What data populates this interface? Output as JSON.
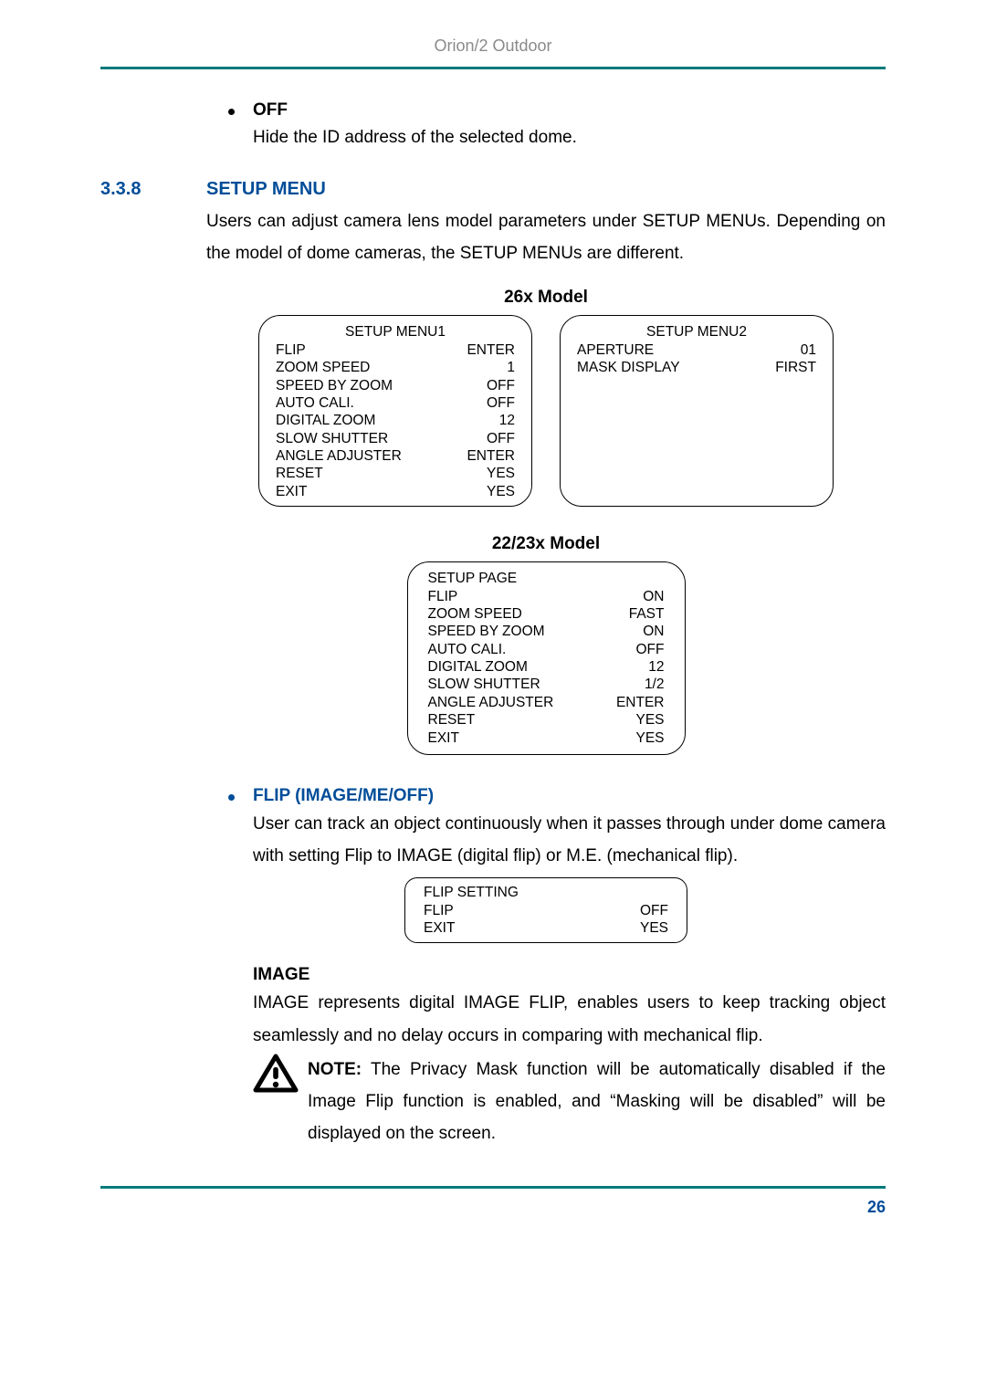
{
  "header": "Orion/2 Outdoor",
  "off_section": {
    "label": "OFF",
    "text": "Hide the ID address of the selected dome."
  },
  "section": {
    "num": "3.3.8",
    "title": "SETUP MENU",
    "body": "Users can adjust camera lens model parameters under SETUP MENUs. Depending on the model of dome cameras, the SETUP MENUs are different."
  },
  "model26": {
    "title": "26x Model",
    "menu1": {
      "title": "SETUP MENU1",
      "rows": [
        {
          "k": "FLIP",
          "v": "ENTER"
        },
        {
          "k": "ZOOM SPEED",
          "v": "1"
        },
        {
          "k": "SPEED BY ZOOM",
          "v": "OFF"
        },
        {
          "k": "AUTO CALI.",
          "v": "OFF"
        },
        {
          "k": "DIGITAL ZOOM",
          "v": "12"
        },
        {
          "k": "SLOW SHUTTER",
          "v": "OFF"
        },
        {
          "k": "ANGLE ADJUSTER",
          "v": "ENTER"
        },
        {
          "k": "RESET",
          "v": "YES"
        },
        {
          "k": "EXIT",
          "v": "YES"
        }
      ]
    },
    "menu2": {
      "title": "SETUP MENU2",
      "rows": [
        {
          "k": "APERTURE",
          "v": "01"
        },
        {
          "k": "MASK DISPLAY",
          "v": "FIRST"
        }
      ]
    }
  },
  "model22": {
    "title": "22/23x Model",
    "menu": {
      "title": "SETUP PAGE",
      "rows": [
        {
          "k": "FLIP",
          "v": "ON"
        },
        {
          "k": "ZOOM SPEED",
          "v": "FAST"
        },
        {
          "k": "SPEED BY ZOOM",
          "v": "ON"
        },
        {
          "k": "AUTO CALI.",
          "v": "OFF"
        },
        {
          "k": "DIGITAL ZOOM",
          "v": "12"
        },
        {
          "k": "SLOW SHUTTER",
          "v": "1/2"
        },
        {
          "k": "ANGLE ADJUSTER",
          "v": "ENTER"
        },
        {
          "k": "RESET",
          "v": "YES"
        },
        {
          "k": "EXIT",
          "v": "YES"
        }
      ]
    }
  },
  "flip_section": {
    "label": "FLIP (IMAGE/ME/OFF)",
    "body": "User can track an object continuously when it passes through under dome camera with setting Flip to IMAGE (digital flip) or M.E. (mechanical flip).",
    "box": {
      "title": "FLIP SETTING",
      "rows": [
        {
          "k": "FLIP",
          "v": "OFF"
        },
        {
          "k": "EXIT",
          "v": "YES"
        }
      ]
    }
  },
  "image_section": {
    "title": "IMAGE",
    "body": "IMAGE represents digital IMAGE FLIP, enables users to keep tracking object seamlessly and no delay occurs in comparing with mechanical flip.",
    "note_bold": "NOTE:",
    "note_text": " The Privacy Mask function will be automatically disabled if the Image Flip function is enabled, and “Masking will be disabled” will be displayed on the screen."
  },
  "page_num": "26"
}
